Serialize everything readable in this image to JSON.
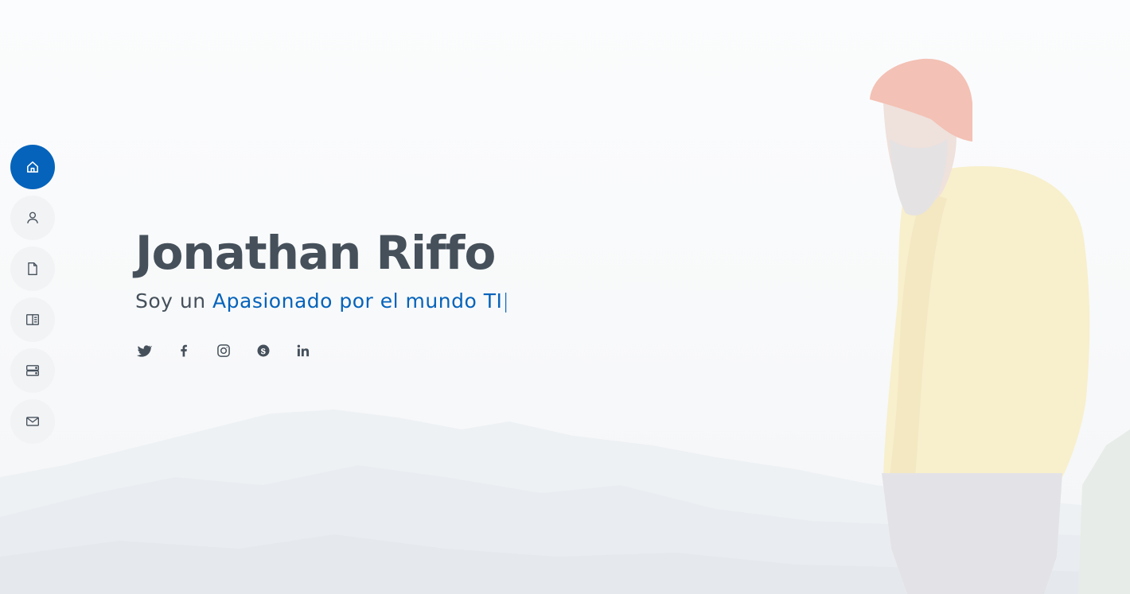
{
  "hero": {
    "name": "Jonathan Riffo",
    "tagline_prefix": "Soy un ",
    "tagline_typed": "Apasionado por el mundo TI",
    "tagline_cursor": "|"
  },
  "nav": {
    "items": [
      {
        "name": "home",
        "icon": "home-icon",
        "active": true
      },
      {
        "name": "about",
        "icon": "person-icon",
        "active": false
      },
      {
        "name": "resume",
        "icon": "file-icon",
        "active": false
      },
      {
        "name": "portfolio",
        "icon": "book-half-icon",
        "active": false
      },
      {
        "name": "services",
        "icon": "server-icon",
        "active": false
      },
      {
        "name": "contact",
        "icon": "envelope-icon",
        "active": false
      }
    ]
  },
  "social": [
    "twitter-icon",
    "facebook-icon",
    "instagram-icon",
    "skype-icon",
    "linkedin-icon"
  ],
  "colors": {
    "accent": "#0563bb",
    "text": "#45505b",
    "nav_bg": "#f2f3f5"
  }
}
